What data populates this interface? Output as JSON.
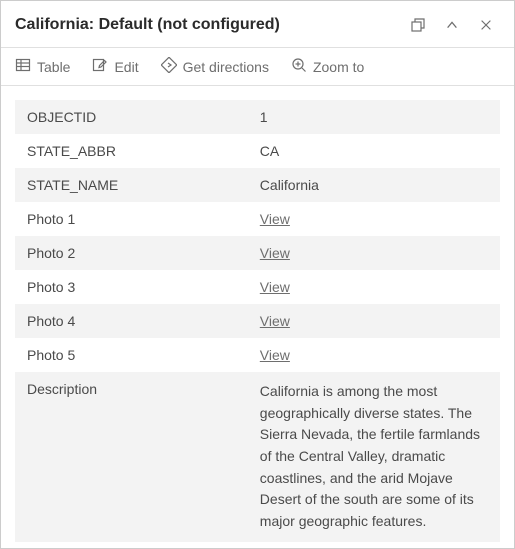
{
  "header": {
    "title": "California: Default (not configured)"
  },
  "toolbar": {
    "table": "Table",
    "edit": "Edit",
    "directions": "Get directions",
    "zoom": "Zoom to"
  },
  "rows": [
    {
      "label": "OBJECTID",
      "value": "1",
      "link": false
    },
    {
      "label": "STATE_ABBR",
      "value": "CA",
      "link": false
    },
    {
      "label": "STATE_NAME",
      "value": "California",
      "link": false
    },
    {
      "label": "Photo 1",
      "value": "View",
      "link": true
    },
    {
      "label": "Photo 2",
      "value": "View",
      "link": true
    },
    {
      "label": "Photo 3",
      "value": "View",
      "link": true
    },
    {
      "label": "Photo 4",
      "value": "View",
      "link": true
    },
    {
      "label": "Photo 5",
      "value": "View",
      "link": true
    },
    {
      "label": "Description",
      "value": "California is among the most geographically diverse states. The Sierra Nevada, the fertile farmlands of the Central Valley, dramatic coastlines, and the arid Mojave Desert of the south are some of its major geographic features.",
      "link": false,
      "desc": true
    }
  ]
}
